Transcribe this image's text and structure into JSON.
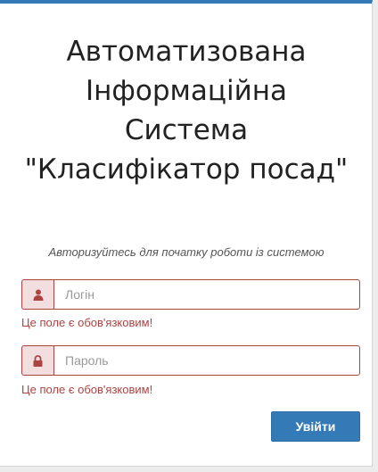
{
  "title": {
    "line1": "Автоматизована",
    "line2": "Інформаційна",
    "line3": "Система",
    "line4": "\"Класифікатор посад\""
  },
  "subtitle": "Авторизуйтесь для початку роботи із системою",
  "login": {
    "placeholder": "Логін",
    "value": "",
    "icon": "user-icon",
    "error": "Це поле є обов'язковим!"
  },
  "password": {
    "placeholder": "Пароль",
    "value": "",
    "icon": "lock-icon",
    "error": "Це поле є обов'язковим!"
  },
  "submit_label": "Увійти",
  "colors": {
    "accent": "#337ab7",
    "error": "#a94442",
    "error_bg": "#f2dede"
  }
}
